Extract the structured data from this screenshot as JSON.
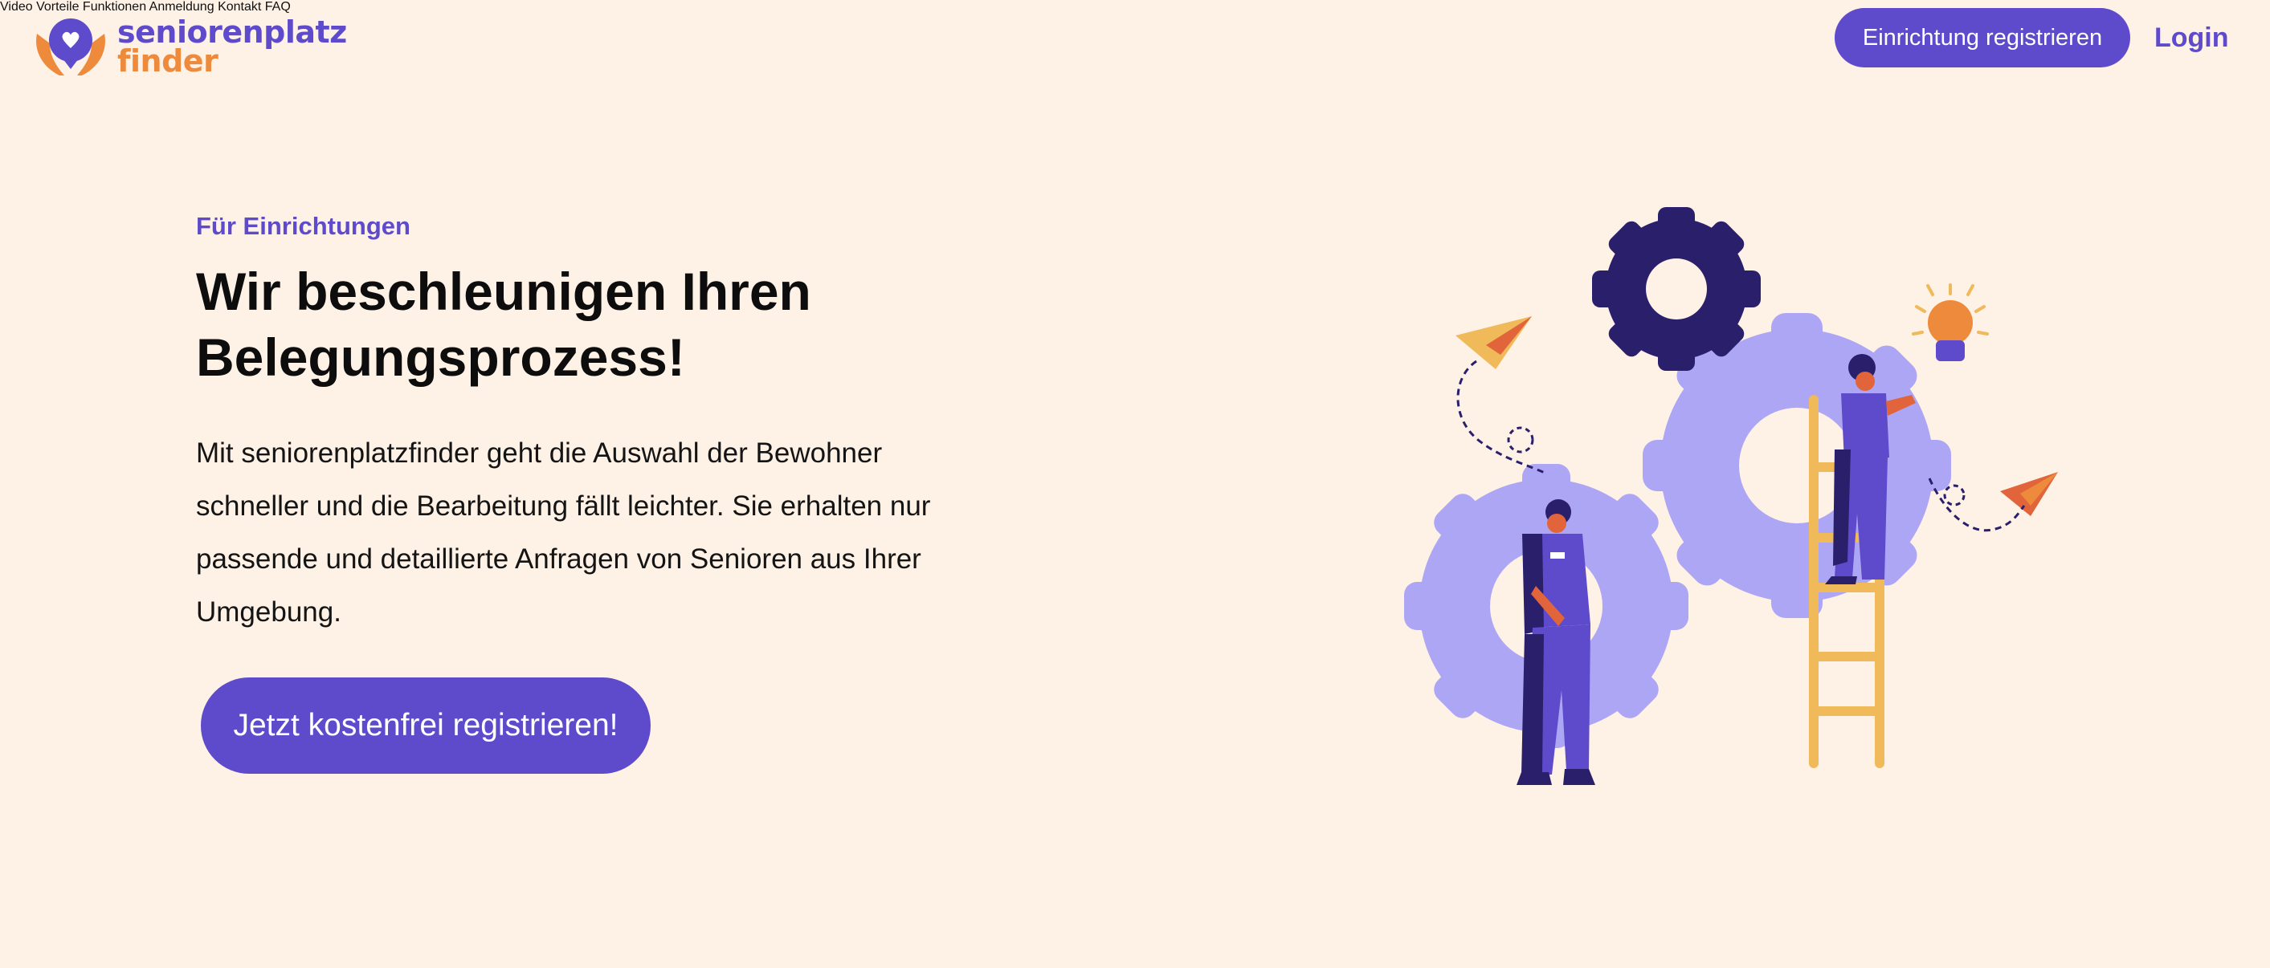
{
  "brand": {
    "name_line1": "seniorenplatz",
    "name_line2": "finder"
  },
  "nav": {
    "items": [
      "Video",
      "Vorteile",
      "Funktionen",
      "Anmeldung",
      "Kontakt",
      "FAQ"
    ]
  },
  "header": {
    "register_label": "Einrichtung registrieren",
    "login_label": "Login"
  },
  "hero": {
    "kicker": "Für Einrichtungen",
    "title_line1": "Wir beschleunigen Ihren",
    "title_line2": "Belegungsprozess!",
    "text_line1": "Mit seniorenplatzfinder geht die Auswahl der Bewohner",
    "text_line2": "schneller und die Bearbeitung fällt leichter. Sie erhalten nur",
    "text_line3": "passende und detaillierte Anfragen von Senioren aus Ihrer",
    "text_line4": "Umgebung.",
    "cta_label": "Jetzt kostenfrei registrieren!"
  },
  "colors": {
    "background": "#fef1e6",
    "primary": "#5d4bcb",
    "accent": "#ee8a3c",
    "gear_light": "#ada6f5",
    "gear_dark": "#2a1f6b",
    "ladder": "#f0b95a"
  },
  "icons": {
    "logo": "heart-hands-logo-icon",
    "illustration": "gears-team-illustration"
  }
}
